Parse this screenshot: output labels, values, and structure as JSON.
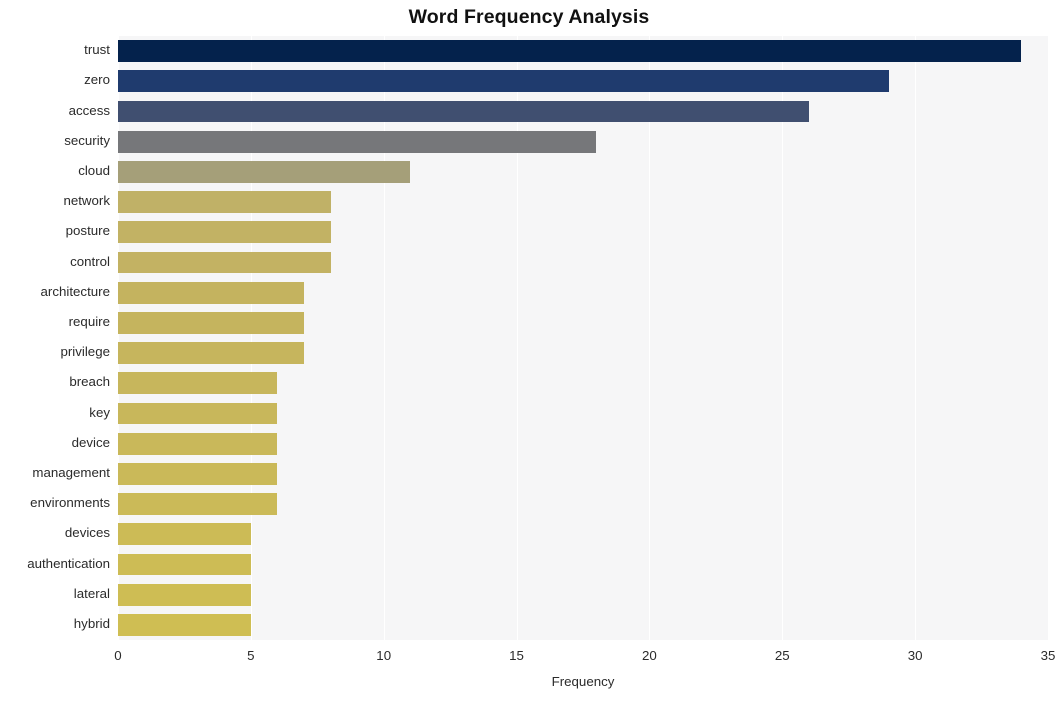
{
  "chart_data": {
    "type": "bar",
    "orientation": "horizontal",
    "title": "Word Frequency Analysis",
    "xlabel": "Frequency",
    "ylabel": "",
    "xlim": [
      0,
      35
    ],
    "xticks": [
      "0",
      "5",
      "10",
      "15",
      "20",
      "25",
      "30",
      "35"
    ],
    "xtick_values": [
      0,
      5,
      10,
      15,
      20,
      25,
      30,
      35
    ],
    "grid": true,
    "legend": "none",
    "plot_background": "#f6f6f7",
    "figure_background": "#ffffff",
    "categories": [
      "trust",
      "zero",
      "access",
      "security",
      "cloud",
      "network",
      "posture",
      "control",
      "architecture",
      "require",
      "privilege",
      "breach",
      "key",
      "device",
      "management",
      "environments",
      "devices",
      "authentication",
      "lateral",
      "hybrid"
    ],
    "values": [
      34,
      29,
      26,
      18,
      11,
      8,
      8,
      8,
      7,
      7,
      7,
      6,
      6,
      6,
      6,
      6,
      5,
      5,
      5,
      5
    ],
    "colors": [
      "#04224c",
      "#1f3b6e",
      "#404f70",
      "#76777a",
      "#a59f79",
      "#c0b167",
      "#c2b264",
      "#c3b263",
      "#c4b35f",
      "#c5b45e",
      "#c6b55d",
      "#c7b65c",
      "#c8b75b",
      "#c9b85a",
      "#cab959",
      "#cbba58",
      "#ccbb56",
      "#cdbc55",
      "#cebd54",
      "#cfbe53"
    ],
    "bars": [
      {
        "label": "trust",
        "value": 34,
        "color": "#04224c"
      },
      {
        "label": "zero",
        "value": 29,
        "color": "#1f3b6e"
      },
      {
        "label": "access",
        "value": 26,
        "color": "#404f70"
      },
      {
        "label": "security",
        "value": 18,
        "color": "#76777a"
      },
      {
        "label": "cloud",
        "value": 11,
        "color": "#a59f79"
      },
      {
        "label": "network",
        "value": 8,
        "color": "#c0b167"
      },
      {
        "label": "posture",
        "value": 8,
        "color": "#c2b264"
      },
      {
        "label": "control",
        "value": 8,
        "color": "#c3b263"
      },
      {
        "label": "architecture",
        "value": 7,
        "color": "#c4b35f"
      },
      {
        "label": "require",
        "value": 7,
        "color": "#c5b45e"
      },
      {
        "label": "privilege",
        "value": 7,
        "color": "#c6b55d"
      },
      {
        "label": "breach",
        "value": 6,
        "color": "#c7b65c"
      },
      {
        "label": "key",
        "value": 6,
        "color": "#c8b75b"
      },
      {
        "label": "device",
        "value": 6,
        "color": "#c9b85a"
      },
      {
        "label": "management",
        "value": 6,
        "color": "#cab959"
      },
      {
        "label": "environments",
        "value": 6,
        "color": "#cbba58"
      },
      {
        "label": "devices",
        "value": 5,
        "color": "#ccbb56"
      },
      {
        "label": "authentication",
        "value": 5,
        "color": "#cdbc55"
      },
      {
        "label": "lateral",
        "value": 5,
        "color": "#cebd54"
      },
      {
        "label": "hybrid",
        "value": 5,
        "color": "#cfbe53"
      }
    ]
  }
}
